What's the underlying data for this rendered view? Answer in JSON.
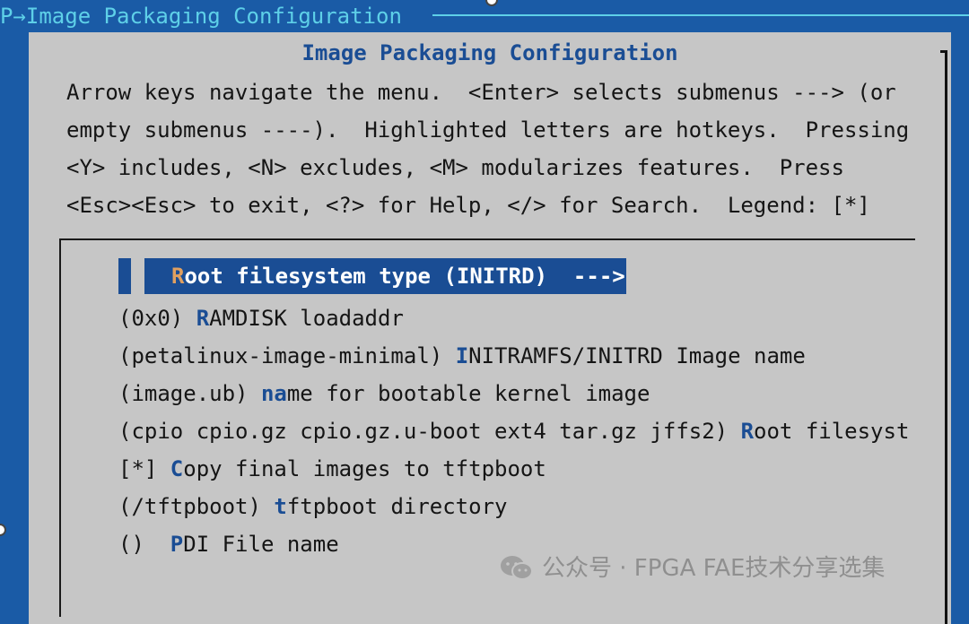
{
  "breadcrumb": {
    "text": "P→Image Packaging Configuration"
  },
  "dialog": {
    "title": "Image Packaging Configuration",
    "help_lines": [
      "Arrow keys navigate the menu.  <Enter> selects submenus ---> (or",
      "empty submenus ----).  Highlighted letters are hotkeys.  Pressing",
      "<Y> includes, <N> excludes, <M> modularizes features.  Press",
      "<Esc><Esc> to exit, <?> for Help, </> for Search.  Legend: [*]"
    ]
  },
  "menu": {
    "selected": {
      "hotkey": "R",
      "rest": "oot filesystem type (INITRD)  --->"
    },
    "items": [
      {
        "prefix": "(0x0) ",
        "hotkey": "R",
        "rest": "AMDISK loadaddr"
      },
      {
        "prefix": "(petalinux-image-minimal) ",
        "hotkey": "I",
        "rest": "NITRAMFS/INITRD Image name"
      },
      {
        "prefix": "(image.ub) ",
        "hotkey": "na",
        "rest": "me for bootable kernel image"
      },
      {
        "prefix": "(cpio cpio.gz cpio.gz.u-boot ext4 tar.gz jffs2) ",
        "hotkey": "R",
        "rest": "oot filesyst"
      },
      {
        "prefix": "[*] ",
        "hotkey": "C",
        "rest": "opy final images to tftpboot"
      },
      {
        "prefix": "(/tftpboot) ",
        "hotkey": "t",
        "rest": "ftpboot directory"
      },
      {
        "prefix": "()  ",
        "hotkey": "P",
        "rest": "DI File name"
      }
    ]
  },
  "watermark": {
    "icon": "wechat-icon",
    "text": "公众号 · FPGA FAE技术分享选集"
  },
  "colors": {
    "background": "#1a5ba6",
    "dialog": "#c6c6c6",
    "accent": "#1a4d94",
    "breadcrumb": "#5ed0e8",
    "selected_hotkey": "#e0a060"
  }
}
